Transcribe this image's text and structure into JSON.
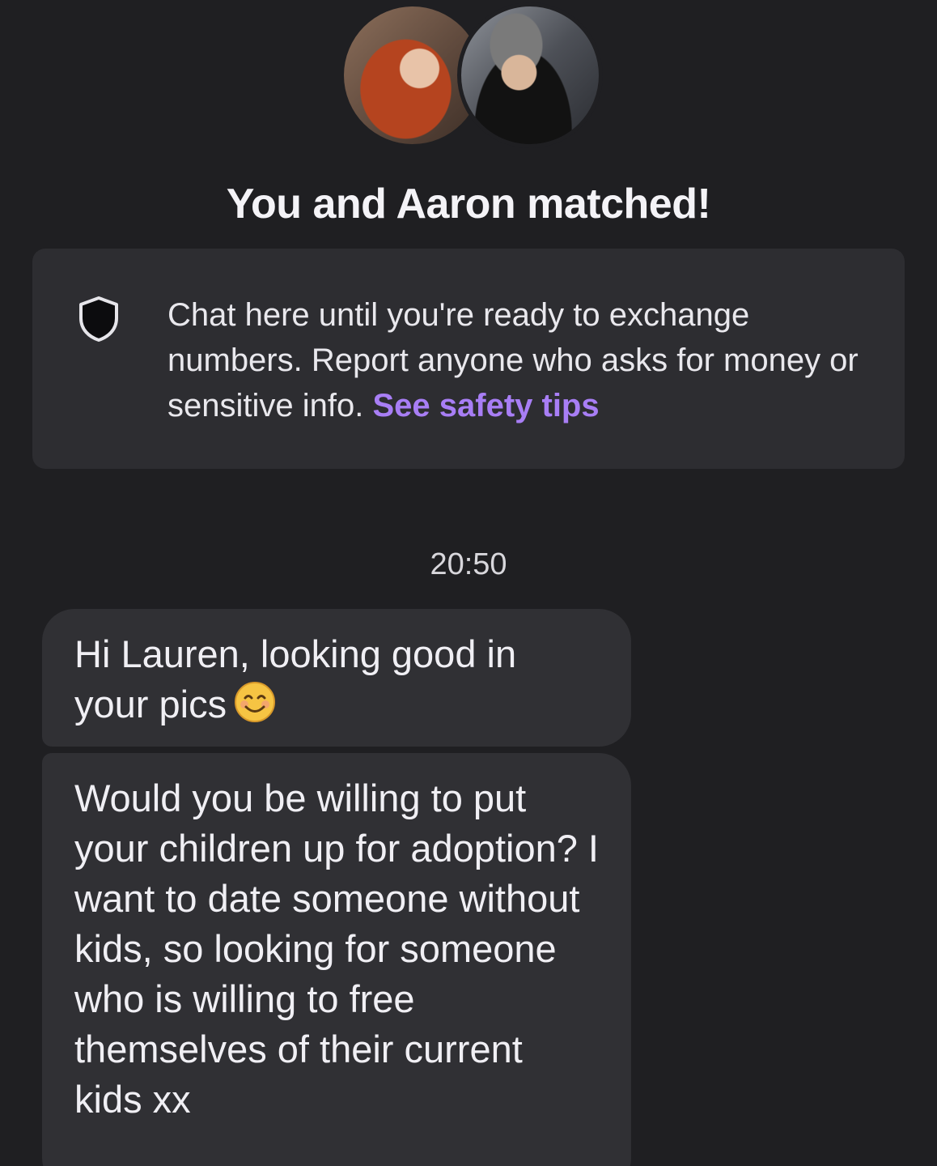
{
  "header": {
    "title": "You and Aaron matched!",
    "avatars": [
      {
        "name": "user-photo",
        "description_icon": "avatar-woman"
      },
      {
        "name": "match-photo",
        "description_icon": "avatar-man"
      }
    ]
  },
  "safety_notice": {
    "icon": "shield-icon",
    "text": "Chat here until you're ready to exchange numbers. Report anyone who asks for money or sensitive info.",
    "link_label": "See safety tips",
    "link_color": "#a87ef5"
  },
  "conversation": {
    "timestamp": "20:50",
    "messages": [
      {
        "text": "Hi Lauren, looking good in your pics",
        "emoji": "smiling-face-emoji"
      },
      {
        "text": "Would you be willing to put your children up for adoption? I want to date someone without kids, so looking for someone who is willing to free themselves of their current kids xx"
      }
    ]
  },
  "colors": {
    "background": "#1f1f22",
    "card": "#2d2d31",
    "bubble": "#303034",
    "text": "#f0eff4"
  }
}
